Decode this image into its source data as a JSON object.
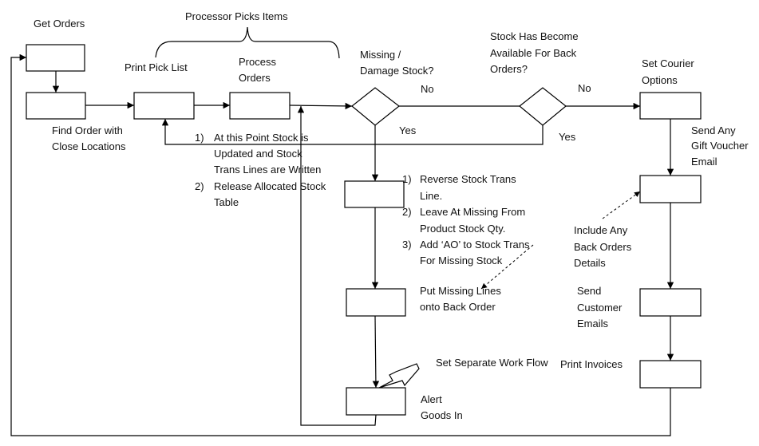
{
  "labels": {
    "get_orders": "Get Orders",
    "processor_picks": "Processor Picks Items",
    "print_pick_list": "Print Pick List",
    "process_orders": [
      "Process",
      "Orders"
    ],
    "missing_damage": [
      "Missing /",
      "Damage Stock?"
    ],
    "stock_available": [
      "Stock Has Become",
      "Available For Back",
      "Orders?"
    ],
    "set_courier": [
      "Set Courier",
      "Options"
    ],
    "find_order": [
      "Find Order with",
      "Close Locations"
    ],
    "no1": "No",
    "no2": "No",
    "yes1": "Yes",
    "yes2": "Yes",
    "gift_voucher": [
      "Send Any",
      "Gift Voucher",
      "Email"
    ],
    "stock_notes": [
      {
        "num": "1)",
        "lines": [
          "At this Point Stock is",
          "Updated and Stock",
          "Trans Lines are Written"
        ]
      },
      {
        "num": "2)",
        "lines": [
          "Release Allocated Stock",
          "Table"
        ]
      }
    ],
    "reverse_notes": [
      {
        "num": "1)",
        "lines": [
          "Reverse Stock Trans",
          "Line."
        ]
      },
      {
        "num": "2)",
        "lines": [
          "Leave At Missing From",
          "Product Stock Qty."
        ]
      },
      {
        "num": "3)",
        "lines": [
          "Add ‘AO’ to Stock Trans",
          "For Missing Stock"
        ]
      }
    ],
    "include_back_orders": [
      "Include Any",
      "Back Orders",
      "Details"
    ],
    "put_missing": [
      "Put Missing Lines",
      "onto Back Order"
    ],
    "send_customer": [
      "Send",
      "Customer",
      "Emails"
    ],
    "set_separate": "Set Separate Work Flow",
    "print_invoices": "Print Invoices",
    "alert_goods": [
      "Alert",
      "Goods In"
    ]
  }
}
